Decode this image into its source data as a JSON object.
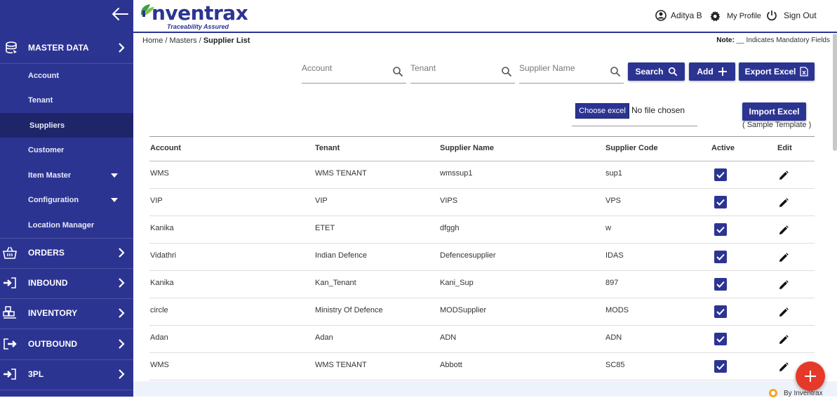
{
  "sidebar": {
    "sections": [
      {
        "label": "MASTER DATA",
        "icon": "master-data-icon"
      },
      {
        "label": "ORDERS",
        "icon": "basket-icon"
      },
      {
        "label": "INBOUND",
        "icon": "sign-in-icon"
      },
      {
        "label": "INVENTORY",
        "icon": "inventory-icon"
      },
      {
        "label": "OUTBOUND",
        "icon": "sign-out-icon"
      },
      {
        "label": "3PL",
        "icon": "sign-in-icon"
      }
    ],
    "master_items": [
      {
        "label": "Account"
      },
      {
        "label": "Tenant"
      },
      {
        "label": "Suppliers"
      },
      {
        "label": "Customer"
      },
      {
        "label": "Item Master"
      },
      {
        "label": "Configuration"
      },
      {
        "label": "Location Manager"
      }
    ]
  },
  "header": {
    "logo_text": "nventrax",
    "logo_tagline": "Traceability Assured",
    "user_name": "Aditya B",
    "my_profile": "My Profile",
    "sign_out": "Sign Out"
  },
  "breadcrumb": {
    "home": "Home",
    "masters": "Masters",
    "current": "Supplier List",
    "sep": " / "
  },
  "note": {
    "label": "Note:",
    "text": " __ Indicates Mandatory Fields"
  },
  "filters": {
    "account_placeholder": "Account",
    "tenant_placeholder": "Tenant",
    "supplier_placeholder": "Supplier Name"
  },
  "buttons": {
    "search": "Search",
    "add": "Add",
    "export": "Export Excel",
    "choose": "Choose excel",
    "no_file": "No file chosen",
    "import": "Import Excel",
    "sample": "( Sample Template )"
  },
  "table": {
    "headers": [
      "Account",
      "Tenant",
      "Supplier Name",
      "Supplier Code",
      "Active",
      "Edit"
    ],
    "rows": [
      {
        "account": "WMS",
        "tenant": "WMS TENANT",
        "supplier": "wmssup1",
        "code": "sup1"
      },
      {
        "account": "VIP",
        "tenant": "VIP",
        "supplier": "VIPS",
        "code": "VPS"
      },
      {
        "account": "Kanika",
        "tenant": "ETET",
        "supplier": "dfggh",
        "code": "w"
      },
      {
        "account": "Vidathri",
        "tenant": "Indian Defence",
        "supplier": "Defencesupplier",
        "code": "IDAS"
      },
      {
        "account": "Kanika",
        "tenant": "Kan_Tenant",
        "supplier": "Kani_Sup",
        "code": "897"
      },
      {
        "account": "circle",
        "tenant": "Ministry Of Defence",
        "supplier": "MODSupplier",
        "code": "MODS"
      },
      {
        "account": "Adan",
        "tenant": "Adan",
        "supplier": "ADN",
        "code": "ADN"
      },
      {
        "account": "WMS",
        "tenant": "WMS TENANT",
        "supplier": "Abbott",
        "code": "SC85"
      }
    ]
  },
  "footer": {
    "by": "By Inventrax"
  },
  "colors": {
    "primary": "#2c3492",
    "fab": "#e53a2a"
  }
}
